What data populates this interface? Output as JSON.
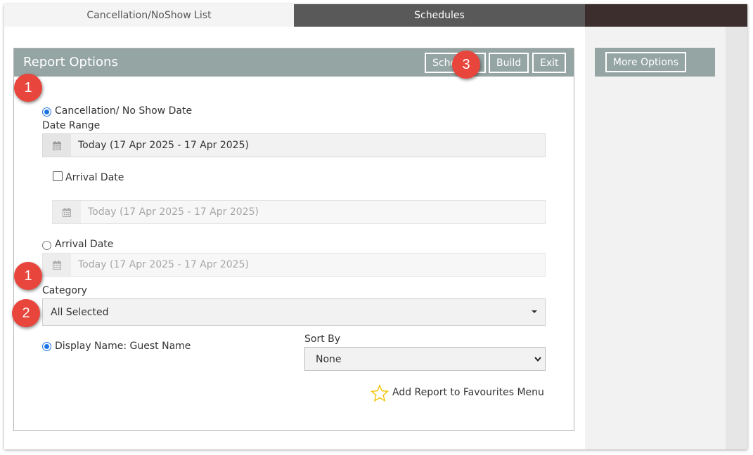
{
  "tabs": {
    "cancellation": "Cancellation/NoShow List",
    "schedules": "Schedules"
  },
  "panel": {
    "title": "Report Options",
    "buttons": {
      "schedule": "Schedule",
      "build": "Build",
      "exit": "Exit"
    }
  },
  "more_options": "More Options",
  "form": {
    "radio_cancel": "Cancellation/ No Show Date",
    "date_range_label": "Date Range",
    "date_range_value": "Today (17 Apr 2025 - 17 Apr 2025)",
    "arrival_checkbox_label": "Arrival Date",
    "arrival_checkbox_range": "Today (17 Apr 2025 - 17 Apr 2025)",
    "radio_arrival": "Arrival Date",
    "arrival_radio_range": "Today (17 Apr 2025 - 17 Apr 2025)",
    "category_label": "Category",
    "category_value": "All Selected",
    "display_name": "Display Name: Guest Name",
    "sort_by_label": "Sort By",
    "sort_by_value": "None",
    "favourites": "Add Report to Favourites Menu"
  },
  "callouts": {
    "one_a": "1",
    "one_b": "1",
    "two": "2",
    "three": "3"
  },
  "colors": {
    "header": "#95a5a3",
    "callout": "#e8453c",
    "radio_checked": "#1a73e8",
    "star": "#f2c200"
  }
}
